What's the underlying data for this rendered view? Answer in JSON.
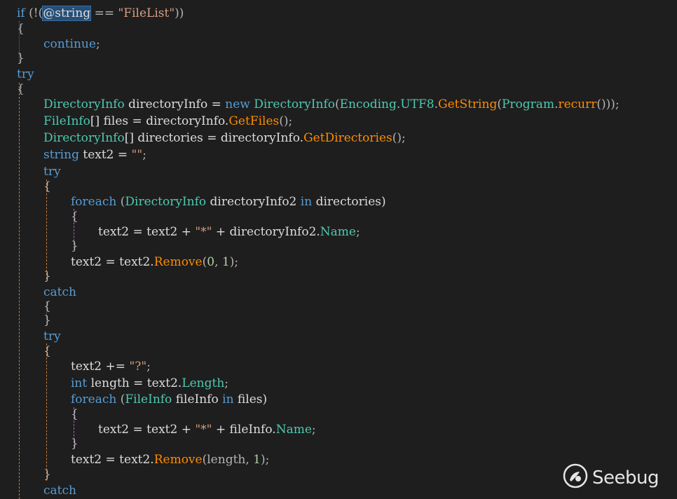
{
  "code": {
    "l1": {
      "if": "if",
      "open": " (!(",
      "sel": "@string",
      "eq": " == ",
      "str": "\"FileList\"",
      "close": "))"
    },
    "l2": {
      "t": "{"
    },
    "l3": {
      "t": "continue",
      "semi": ";"
    },
    "l4": {
      "t": "}"
    },
    "l5": {
      "t": "try"
    },
    "l6": {
      "t": "{"
    },
    "l7": {
      "ty1": "DirectoryInfo",
      "v1": " directoryInfo = ",
      "kw": "new",
      "sp": " ",
      "ty2": "DirectoryInfo",
      "p1": "(",
      "ty3": "Encoding",
      "dot1": ".",
      "pr": "UTF8",
      "dot2": ".",
      "me1": "GetString",
      "p2": "(",
      "ty4": "Program",
      "dot3": ".",
      "me2": "recurr",
      "end": "()));"
    },
    "l8": {
      "ty": "FileInfo",
      "v": "[] files = directoryInfo.",
      "me": "GetFiles",
      "end": "();"
    },
    "l9": {
      "ty": "DirectoryInfo",
      "v": "[] directories = directoryInfo.",
      "me": "GetDirectories",
      "end": "();"
    },
    "l10": {
      "kw": "string",
      "v": " text2 = ",
      "str": "\"\"",
      "end": ";"
    },
    "l11": {
      "t": "try"
    },
    "l12": {
      "t": "{"
    },
    "l13": {
      "kw": "foreach",
      "p": " (",
      "ty": "DirectoryInfo",
      "v": " directoryInfo2 ",
      "kw2": "in",
      "end": " directories)"
    },
    "l14": {
      "t": "{"
    },
    "l15": {
      "v": "text2 = text2 + ",
      "str": "\"*\"",
      "v2": " + directoryInfo2.",
      "pr": "Name",
      "end": ";"
    },
    "l16": {
      "t": "}"
    },
    "l17": {
      "v": "text2 = text2.",
      "me": "Remove",
      "p": "(",
      "n1": "0",
      "c": ", ",
      "n2": "1",
      "end": ");"
    },
    "l18": {
      "t": "}"
    },
    "l19": {
      "t": "catch"
    },
    "l20": {
      "t": "{"
    },
    "l21": {
      "t": "}"
    },
    "l22": {
      "t": "try"
    },
    "l23": {
      "t": "{"
    },
    "l24": {
      "v": "text2 += ",
      "str": "\"?\"",
      "end": ";"
    },
    "l25": {
      "kw": "int",
      "v": " length = text2.",
      "pr": "Length",
      "end": ";"
    },
    "l26": {
      "kw": "foreach",
      "p": " (",
      "ty": "FileInfo",
      "v": " fileInfo ",
      "kw2": "in",
      "end": " files)"
    },
    "l27": {
      "t": "{"
    },
    "l28": {
      "v": "text2 = text2 + ",
      "str": "\"*\"",
      "v2": " + fileInfo.",
      "pr": "Name",
      "end": ";"
    },
    "l29": {
      "t": "}"
    },
    "l30": {
      "v": "text2 = text2.",
      "me": "Remove",
      "p": "(length, ",
      "n": "1",
      "end": ");"
    },
    "l31": {
      "t": "}"
    },
    "l32": {
      "t": "catch"
    }
  },
  "watermark": {
    "text": "Seebug",
    "icon": "seebug-bug-icon"
  },
  "colors": {
    "background": "#1e1e1e",
    "keyword": "#569cd6",
    "type": "#4ec9b0",
    "string": "#d69d85",
    "method": "#ff8c00",
    "selection": "#264f78"
  }
}
